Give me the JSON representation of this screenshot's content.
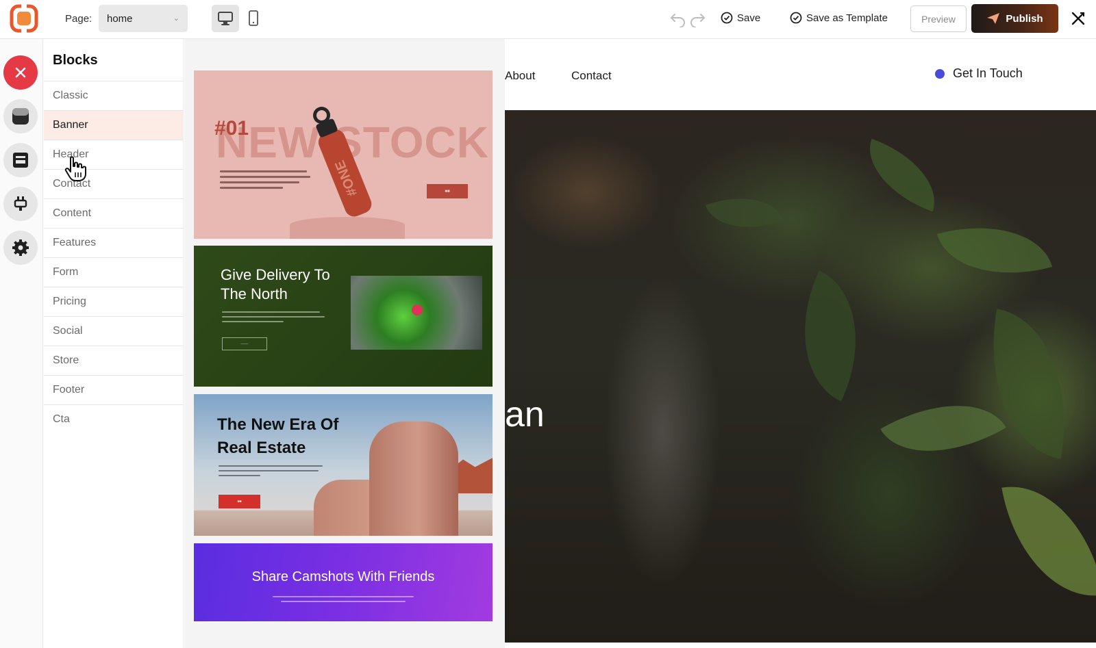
{
  "toolbar": {
    "page_label": "Page:",
    "page_value": "home",
    "save_label": "Save",
    "save_template_label": "Save as Template",
    "preview_label": "Preview",
    "publish_label": "Publish"
  },
  "blocks_panel": {
    "title": "Blocks",
    "items": [
      {
        "label": "Classic"
      },
      {
        "label": "Banner"
      },
      {
        "label": "Header"
      },
      {
        "label": "Contact"
      },
      {
        "label": "Content"
      },
      {
        "label": "Features"
      },
      {
        "label": "Form"
      },
      {
        "label": "Pricing"
      },
      {
        "label": "Social"
      },
      {
        "label": "Store"
      },
      {
        "label": "Footer"
      },
      {
        "label": "Cta"
      }
    ],
    "active_index": 1
  },
  "thumbnails": [
    {
      "number": "#01",
      "headline": "NEW STOCK",
      "bottle_text": "#ONE"
    },
    {
      "headline_line1": "Give Delivery To",
      "headline_line2": "The North"
    },
    {
      "headline_line1": "The New Era Of",
      "headline_line2": "Real Estate"
    },
    {
      "headline": "Share Camshots With Friends"
    }
  ],
  "site": {
    "nav": [
      "About",
      "Contact"
    ],
    "cta": "Get In Touch",
    "hero_fragment": "an"
  },
  "colors": {
    "accent": "#e63946",
    "publish_from": "#1f1a17",
    "publish_to": "#7a3414",
    "banner_active_bg": "#fdece6",
    "cta_dot": "#4c4bd8"
  },
  "icons": [
    "app-logo-icon",
    "desktop-icon",
    "mobile-icon",
    "undo-icon",
    "redo-icon",
    "check-circle-icon",
    "send-icon",
    "tools-icon",
    "close-icon",
    "theme-icon",
    "layout-icon",
    "plugin-icon",
    "gear-icon",
    "pointer-hand-icon"
  ]
}
